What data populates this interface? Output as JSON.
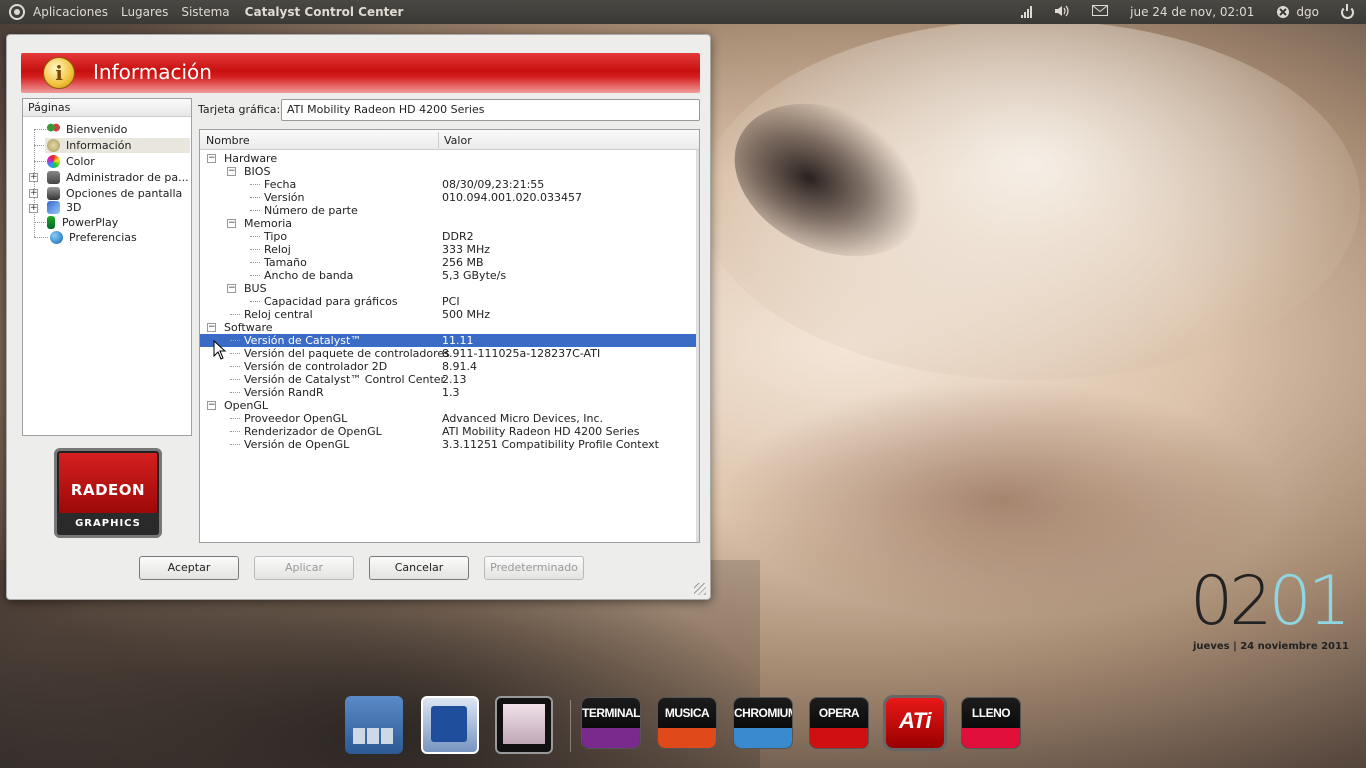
{
  "top_panel": {
    "menus": [
      "Aplicaciones",
      "Lugares",
      "Sistema"
    ],
    "active_app": "Catalyst Control Center",
    "clock": "jue 24 de nov, 02:01",
    "user": "dgo"
  },
  "window": {
    "header_title": "Información",
    "pages_header": "Páginas",
    "pages": [
      {
        "label": "Bienvenido",
        "icon": "people-icon"
      },
      {
        "label": "Información",
        "icon": "info-icon",
        "selected": true
      },
      {
        "label": "Color",
        "icon": "color-wheel-icon"
      },
      {
        "label": "Administrador de pa...",
        "icon": "monitor-icon",
        "expandable": true
      },
      {
        "label": "Opciones de pantalla",
        "icon": "display-icon",
        "expandable": true
      },
      {
        "label": "3D",
        "icon": "cube-icon",
        "expandable": true
      },
      {
        "label": "PowerPlay",
        "icon": "battery-icon"
      },
      {
        "label": "Preferencias",
        "icon": "globe-icon"
      }
    ],
    "logo": {
      "line1": "RADEON",
      "line2": "GRAPHICS"
    },
    "card_label": "Tarjeta gráfica:",
    "card_value": "ATI Mobility Radeon HD 4200 Series",
    "columns": [
      "Nombre",
      "Valor"
    ],
    "rows": [
      {
        "level": 0,
        "name": "Hardware",
        "value": "",
        "expander": true
      },
      {
        "level": 1,
        "name": "BIOS",
        "value": "",
        "expander": true
      },
      {
        "level": 2,
        "name": "Fecha",
        "value": "08/30/09,23:21:55"
      },
      {
        "level": 2,
        "name": "Versión",
        "value": "010.094.001.020.033457"
      },
      {
        "level": 2,
        "name": "Número de parte",
        "value": ""
      },
      {
        "level": 1,
        "name": "Memoria",
        "value": "",
        "expander": true
      },
      {
        "level": 2,
        "name": "Tipo",
        "value": "DDR2"
      },
      {
        "level": 2,
        "name": "Reloj",
        "value": "333 MHz"
      },
      {
        "level": 2,
        "name": "Tamaño",
        "value": "256 MB"
      },
      {
        "level": 2,
        "name": "Ancho de banda",
        "value": "5,3 GByte/s"
      },
      {
        "level": 1,
        "name": "BUS",
        "value": "",
        "expander": true
      },
      {
        "level": 2,
        "name": "Capacidad para gráficos",
        "value": "PCI"
      },
      {
        "level": 1,
        "name": "Reloj central",
        "value": "500 MHz"
      },
      {
        "level": 0,
        "name": "Software",
        "value": "",
        "expander": true
      },
      {
        "level": 1,
        "name": "Versión de Catalyst™",
        "value": "11.11",
        "selected": true
      },
      {
        "level": 1,
        "name": "Versión del paquete de controladores",
        "value": "8.911-111025a-128237C-ATI"
      },
      {
        "level": 1,
        "name": "Versión de controlador 2D",
        "value": "8.91.4"
      },
      {
        "level": 1,
        "name": "Versión de Catalyst™ Control Center",
        "value": "2.13"
      },
      {
        "level": 1,
        "name": "Versión RandR",
        "value": "1.3"
      },
      {
        "level": 0,
        "name": "OpenGL",
        "value": "",
        "expander": true
      },
      {
        "level": 1,
        "name": "Proveedor OpenGL",
        "value": "Advanced Micro Devices, Inc."
      },
      {
        "level": 1,
        "name": "Renderizador de OpenGL",
        "value": "ATI Mobility Radeon HD 4200 Series"
      },
      {
        "level": 1,
        "name": "Versión de OpenGL",
        "value": "3.3.11251 Compatibility Profile Context"
      }
    ],
    "buttons": {
      "accept": "Aceptar",
      "apply": "Aplicar",
      "cancel": "Cancelar",
      "defaults": "Predeterminado"
    }
  },
  "clock_widget": {
    "hours": "02",
    "minutes": "01",
    "date": "jueves | 24 noviembre 2011"
  },
  "dock": {
    "items": [
      {
        "label": "",
        "icon": "workspace-switcher-icon"
      },
      {
        "label": "",
        "icon": "text-editor-icon"
      },
      {
        "label": "",
        "icon": "window-preview-icon"
      },
      {
        "label": "TERMINAL",
        "icon": "terminal-icon",
        "color": "#7a2a8c"
      },
      {
        "label": "MUSICA",
        "icon": "music-icon",
        "color": "#e04a1a"
      },
      {
        "label": "CHROMIUM",
        "icon": "chromium-icon",
        "color": "#3a8ad0"
      },
      {
        "label": "OPERA",
        "icon": "opera-icon",
        "color": "#d01010"
      },
      {
        "label": "ATi",
        "icon": "ati-icon",
        "color": "#e01010"
      },
      {
        "label": "LLENO",
        "icon": "trash-full-icon",
        "color": "#e0103a"
      }
    ]
  }
}
